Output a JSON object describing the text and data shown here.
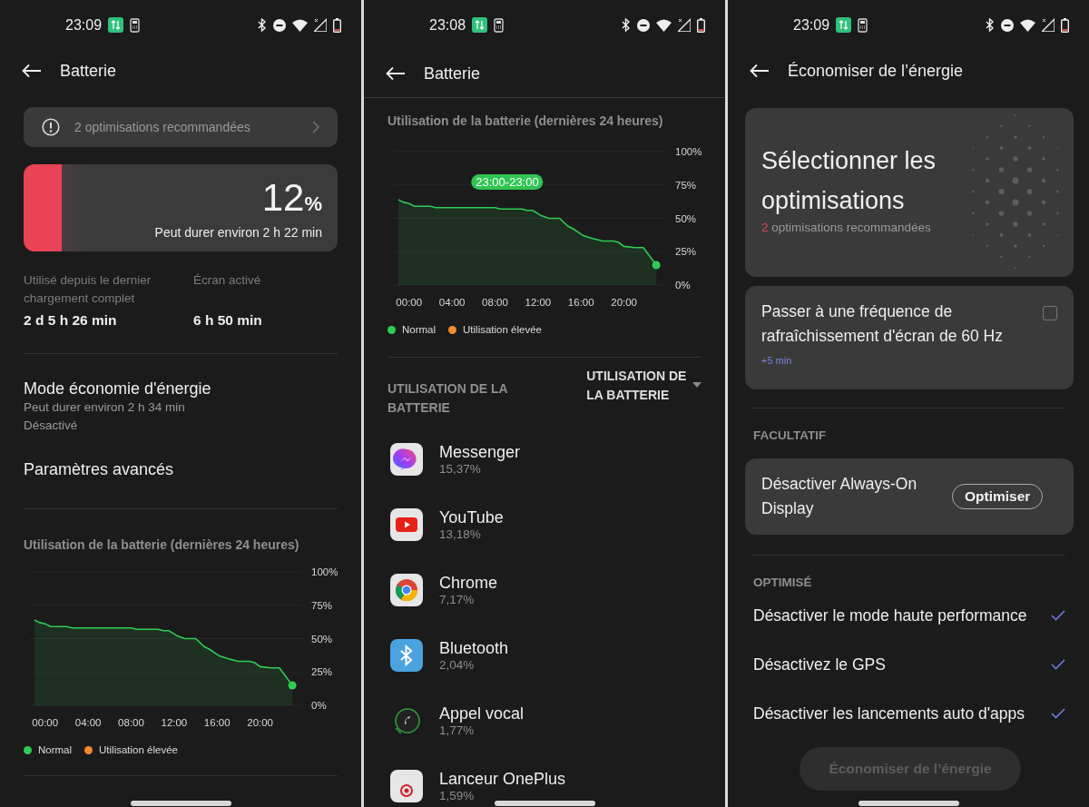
{
  "screens": [
    {
      "kind": "overview",
      "status_time": "23:09",
      "title": "Batterie",
      "banner": "2 optimisations recommandées",
      "battery": {
        "level": 0.12,
        "percent": "12",
        "unit": "%",
        "estimate": "Peut durer environ 2 h 22 min"
      },
      "stats": [
        {
          "label": "Utilisé depuis le dernier chargement complet",
          "value": "2 d 5 h 26 min"
        },
        {
          "label": "Écran activé",
          "value": "6 h 50 min"
        }
      ],
      "power_saving": {
        "title": "Mode économie d'énergie",
        "subtitle": "Peut durer environ 2 h 34 min",
        "status": "Désactivé"
      },
      "advanced": "Paramètres avancés",
      "usage_title": "Utilisation de la batterie (dernières 24 heures)",
      "chart_data": {
        "type": "area",
        "grid": true,
        "x": [
          -1,
          -0.5,
          0,
          0.5,
          2,
          2.5,
          3,
          8,
          8.5,
          9,
          10.5,
          11,
          11.5,
          12.3,
          13,
          14,
          14.8,
          15.3,
          16.2,
          17,
          18,
          19,
          19.5,
          20,
          21,
          21.8,
          23
        ],
        "series": [
          {
            "name": "Normal",
            "color": "#2ecc55",
            "values": [
              64,
              62,
              61,
              59,
              59,
              58,
              58,
              58,
              57,
              57,
              57,
              56,
              56,
              52,
              50,
              50,
              44,
              42,
              37,
              35,
              33,
              33,
              32,
              29,
              28,
              28,
              15
            ]
          }
        ],
        "xlim": [
          -1.5,
          24
        ],
        "ylim": [
          0,
          100
        ],
        "xticks": [
          {
            "value": 0,
            "label": "00:00"
          },
          {
            "value": 4,
            "label": "04:00"
          },
          {
            "value": 8,
            "label": "08:00"
          },
          {
            "value": 12,
            "label": "12:00"
          },
          {
            "value": 16,
            "label": "16:00"
          },
          {
            "value": 20,
            "label": "20:00"
          }
        ],
        "yticks": [
          {
            "value": 0,
            "label": "0%"
          },
          {
            "value": 25,
            "label": "25%"
          },
          {
            "value": 50,
            "label": "50%"
          },
          {
            "value": 75,
            "label": "75%"
          },
          {
            "value": 100,
            "label": "100%"
          }
        ]
      },
      "legend": [
        {
          "label": "Utilisation élevée",
          "color": "#f28a30"
        }
      ]
    },
    {
      "kind": "usage",
      "status_time": "23:08",
      "title": "Batterie",
      "usage_title": "Utilisation de la batterie (dernières 24 heures)",
      "tooltip": "23:00-23:00",
      "chart_data": {
        "type": "area",
        "grid": true,
        "x": [
          -1,
          -0.5,
          0,
          0.5,
          2,
          2.5,
          3,
          8,
          8.5,
          9,
          10.5,
          11,
          11.5,
          12.3,
          13,
          14,
          14.8,
          15.3,
          16.2,
          17,
          18,
          19,
          19.5,
          20,
          21,
          21.8,
          23
        ],
        "series": [
          {
            "name": "Normal",
            "color": "#2ecc55",
            "values": [
              64,
              62,
              61,
              59,
              59,
              58,
              58,
              58,
              57,
              57,
              57,
              56,
              56,
              52,
              50,
              50,
              44,
              42,
              37,
              35,
              33,
              33,
              32,
              29,
              28,
              28,
              15
            ]
          }
        ],
        "xlim": [
          -1.5,
          24
        ],
        "ylim": [
          0,
          100
        ],
        "xticks": [
          {
            "value": 0,
            "label": "00:00"
          },
          {
            "value": 4,
            "label": "04:00"
          },
          {
            "value": 8,
            "label": "08:00"
          },
          {
            "value": 12,
            "label": "12:00"
          },
          {
            "value": 16,
            "label": "16:00"
          },
          {
            "value": 20,
            "label": "20:00"
          }
        ],
        "yticks": [
          {
            "value": 0,
            "label": "0%"
          },
          {
            "value": 25,
            "label": "25%"
          },
          {
            "value": 50,
            "label": "50%"
          },
          {
            "value": 75,
            "label": "75%"
          },
          {
            "value": 100,
            "label": "100%"
          }
        ]
      },
      "legend": [
        {
          "label": "Utilisation élevée",
          "color": "#f28a30"
        }
      ],
      "list_header": {
        "left": "UTILISATION DE LA BATTERIE",
        "right": "UTILISATION DE LA BATTERIE"
      },
      "apps": [
        {
          "kind": "messenger",
          "name": "Messenger",
          "percent": "15,37%"
        },
        {
          "kind": "youtube",
          "name": "YouTube",
          "percent": "13,18%"
        },
        {
          "kind": "chrome",
          "name": "Chrome",
          "percent": "7,17%"
        },
        {
          "kind": "bluetooth",
          "name": "Bluetooth",
          "percent": "2,04%"
        },
        {
          "kind": "phone",
          "name": "Appel vocal",
          "percent": "1,77%"
        },
        {
          "kind": "launcher",
          "name": "Lanceur OnePlus",
          "percent": "1,59%"
        }
      ]
    },
    {
      "kind": "optimize",
      "status_time": "23:09",
      "title": "Économiser de l’énergie",
      "hero": {
        "title": "Sélectionner les optimisations",
        "count": "2",
        "text": "optimisations recommandées"
      },
      "suggestion": {
        "text": "Passer à une fréquence de rafraîchissement d'écran de 60 Hz",
        "gain": "+5 min",
        "checked": false
      },
      "optional_header": "FACULTATIF",
      "optional": {
        "text": "Désactiver Always-On Display",
        "button": "Optimiser"
      },
      "optimized_header": "OPTIMISÉ",
      "optimized": [
        {
          "text": "Désactiver le mode haute performance",
          "checked": true
        },
        {
          "text": "Désactivez le GPS",
          "checked": true
        },
        {
          "text": "Désactiver les lancements auto d'apps",
          "checked": true
        }
      ],
      "save_button": {
        "label": "Économiser de l’énergie",
        "disabled": true
      }
    }
  ]
}
